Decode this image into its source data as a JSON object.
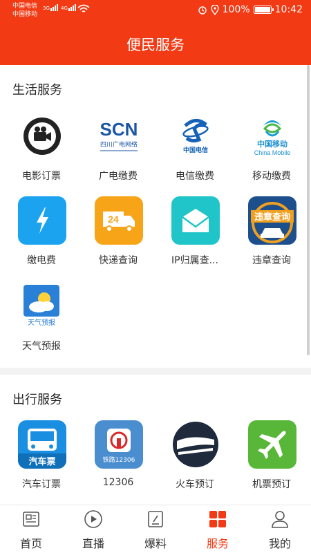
{
  "status_bar": {
    "carrier1": "中国电信",
    "carrier2": "中国移动",
    "net1": "3G",
    "net2": "4G",
    "battery": "100%",
    "time": "10:42"
  },
  "header": {
    "title": "便民服务"
  },
  "life_section": {
    "title": "生活服务",
    "items": [
      {
        "label": "电影订票",
        "icon": "film-camera-icon"
      },
      {
        "label": "广电缴费",
        "icon": "scn-logo-icon",
        "logo_text": "SCN",
        "logo_sub": "四川广电网络"
      },
      {
        "label": "电信缴费",
        "icon": "china-telecom-icon",
        "logo_text": "中国电信"
      },
      {
        "label": "移动缴费",
        "icon": "china-mobile-icon",
        "logo_text": "中国移动",
        "logo_sub": "China Mobile"
      },
      {
        "label": "缴电费",
        "icon": "lightning-icon"
      },
      {
        "label": "快递查询",
        "icon": "delivery-truck-icon",
        "badge": "24"
      },
      {
        "label": "IP归属查...",
        "icon": "envelope-icon"
      },
      {
        "label": "违章查询",
        "icon": "traffic-violation-icon",
        "logo_text": "违章查询"
      },
      {
        "label": "天气预报",
        "icon": "weather-icon",
        "logo_text": "天气预报"
      }
    ]
  },
  "travel_section": {
    "title": "出行服务",
    "items": [
      {
        "label": "汽车订票",
        "icon": "bus-icon",
        "logo_text": "汽车票"
      },
      {
        "label": "12306",
        "icon": "railway-12306-icon",
        "logo_sub": "铁路12306"
      },
      {
        "label": "火车预订",
        "icon": "train-icon"
      },
      {
        "label": "机票预订",
        "icon": "airplane-icon"
      }
    ]
  },
  "tabbar": {
    "items": [
      {
        "label": "首页",
        "icon": "newspaper-icon"
      },
      {
        "label": "直播",
        "icon": "play-icon"
      },
      {
        "label": "爆料",
        "icon": "edit-icon"
      },
      {
        "label": "服务",
        "icon": "grid-icon",
        "active": true
      },
      {
        "label": "我的",
        "icon": "user-icon"
      }
    ]
  },
  "colors": {
    "brand": "#f23a14",
    "active_tab": "#f23a14"
  }
}
